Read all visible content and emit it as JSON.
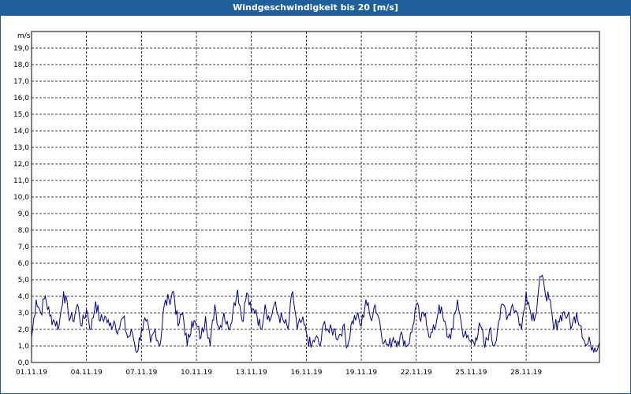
{
  "window": {
    "title": "Windgeschwindigkeit bis 20 [m/s]"
  },
  "colors": {
    "titlebar": "#1f5f9b",
    "series": "#00008b",
    "grid": "#000000"
  },
  "chart_data": {
    "type": "line",
    "title": "Windgeschwindigkeit bis 20 [m/s]",
    "ylabel": "m/s",
    "xlabel": "",
    "ylim": [
      0,
      20
    ],
    "xlim_days": [
      0,
      31
    ],
    "grid": true,
    "y_ticks": [
      "0,0",
      "1,0",
      "2,0",
      "3,0",
      "4,0",
      "5,0",
      "6,0",
      "7,0",
      "8,0",
      "9,0",
      "10,0",
      "11,0",
      "12,0",
      "13,0",
      "14,0",
      "15,0",
      "16,0",
      "17,0",
      "18,0",
      "19,0"
    ],
    "x_ticks": [
      "01.11.19",
      "04.11.19",
      "07.11.19",
      "10.11.19",
      "13.11.19",
      "16.11.19",
      "19.11.19",
      "22.11.19",
      "25.11.19",
      "28.11.19"
    ],
    "series": [
      {
        "name": "",
        "x": [
          0.0,
          0.25,
          0.5,
          0.75,
          1.0,
          1.25,
          1.5,
          1.75,
          2.0,
          2.25,
          2.5,
          2.75,
          3.0,
          3.25,
          3.5,
          3.75,
          4.0,
          4.25,
          4.5,
          4.75,
          5.0,
          5.25,
          5.5,
          5.75,
          6.0,
          6.25,
          6.5,
          6.75,
          7.0,
          7.25,
          7.5,
          7.75,
          8.0,
          8.25,
          8.5,
          8.75,
          9.0,
          9.25,
          9.5,
          9.75,
          10.0,
          10.25,
          10.5,
          10.75,
          11.0,
          11.25,
          11.5,
          11.75,
          12.0,
          12.25,
          12.5,
          12.75,
          13.0,
          13.25,
          13.5,
          13.75,
          14.0,
          14.25,
          14.5,
          14.75,
          15.0,
          15.25,
          15.5,
          15.75,
          16.0,
          16.25,
          16.5,
          16.75,
          17.0,
          17.25,
          17.5,
          17.75,
          18.0,
          18.25,
          18.5,
          18.75,
          19.0,
          19.25,
          19.5,
          19.75,
          20.0,
          20.25,
          20.5,
          20.75,
          21.0,
          21.25,
          21.5,
          21.75,
          22.0,
          22.25,
          22.5,
          22.75,
          23.0,
          23.25,
          23.5,
          23.75,
          24.0,
          24.25,
          24.5,
          24.75,
          25.0,
          25.25,
          25.5,
          25.75,
          26.0,
          26.25,
          26.5,
          26.75,
          27.0,
          27.25,
          27.5,
          27.75,
          28.0,
          28.25,
          28.5,
          28.75,
          29.0,
          29.25,
          29.5,
          29.75,
          30.0,
          30.25,
          30.5,
          30.75,
          31.0
        ],
        "values": [
          1.5,
          3.8,
          3.0,
          4.0,
          2.8,
          2.5,
          2.2,
          4.3,
          3.0,
          2.5,
          3.5,
          2.2,
          3.2,
          2.0,
          3.7,
          2.5,
          2.8,
          2.2,
          2.5,
          2.0,
          2.7,
          1.5,
          1.8,
          0.6,
          2.0,
          2.5,
          1.2,
          2.0,
          1.0,
          3.5,
          3.8,
          4.3,
          2.2,
          3.0,
          1.0,
          2.5,
          2.2,
          1.5,
          2.8,
          1.0,
          3.5,
          2.0,
          3.0,
          2.0,
          3.2,
          4.4,
          2.5,
          4.2,
          3.0,
          3.2,
          2.0,
          3.5,
          2.5,
          3.5,
          2.8,
          2.5,
          2.0,
          4.3,
          2.0,
          2.5,
          1.8,
          0.9,
          1.5,
          1.0,
          2.5,
          1.8,
          2.0,
          1.5,
          2.2,
          1.0,
          2.5,
          2.8,
          2.2,
          3.8,
          2.7,
          3.5,
          2.5,
          1.2,
          1.0,
          1.5,
          1.3,
          1.6,
          1.0,
          1.8,
          3.5,
          2.5,
          3.0,
          1.5,
          2.0,
          3.5,
          2.5,
          1.5,
          2.0,
          3.8,
          2.0,
          1.5,
          1.2,
          1.5,
          2.2,
          0.9,
          2.0,
          1.0,
          2.5,
          3.5,
          2.8,
          3.5,
          3.0,
          2.0,
          4.3,
          3.0,
          2.8,
          5.2,
          4.5,
          3.8,
          2.0,
          2.5,
          3.0,
          2.8,
          2.2,
          3.0,
          2.2,
          1.0,
          1.2,
          0.9,
          1.2
        ]
      }
    ]
  }
}
